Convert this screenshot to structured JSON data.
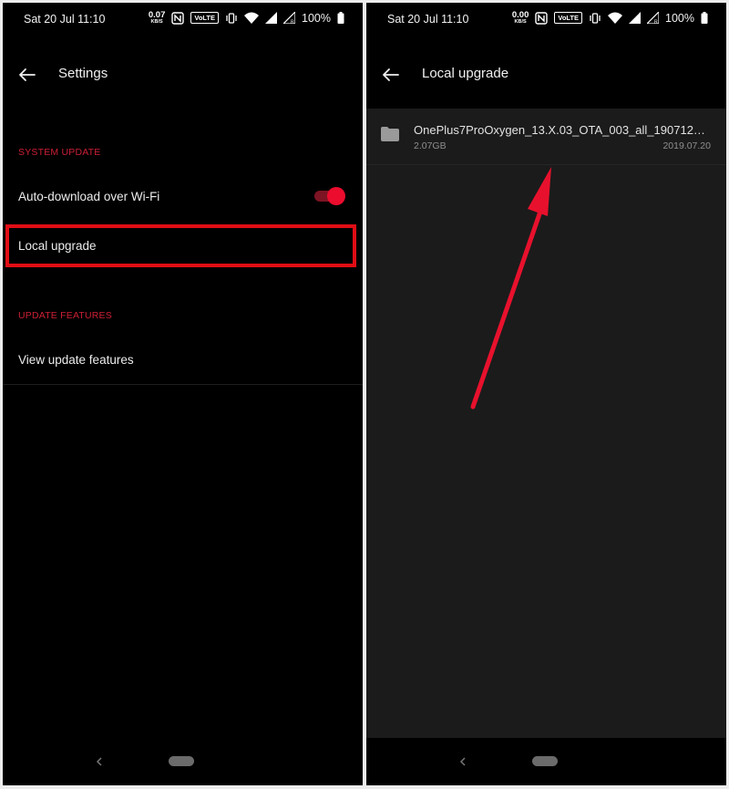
{
  "left_screen": {
    "status_bar": {
      "time": "Sat 20 Jul 11:10",
      "net_speed": "0.07",
      "net_speed_unit": "KB/S",
      "volte": "VoLTE",
      "battery": "100%"
    },
    "app_bar": {
      "title": "Settings"
    },
    "sections": [
      {
        "header": "SYSTEM UPDATE",
        "items": [
          {
            "label": "Auto-download over Wi-Fi",
            "toggle_on": true
          },
          {
            "label": "Local upgrade",
            "highlighted": true
          }
        ]
      },
      {
        "header": "UPDATE FEATURES",
        "items": [
          {
            "label": "View update features"
          }
        ]
      }
    ]
  },
  "right_screen": {
    "status_bar": {
      "time": "Sat 20 Jul 11:10",
      "net_speed": "0.00",
      "net_speed_unit": "KB/S",
      "volte": "VoLTE",
      "battery": "100%"
    },
    "app_bar": {
      "title": "Local upgrade"
    },
    "files": [
      {
        "name": "OnePlus7ProOxygen_13.X.03_OTA_003_all_19071222...",
        "size": "2.07GB",
        "date": "2019.07.20",
        "icon": "folder-icon"
      }
    ]
  },
  "colors": {
    "accent": "#eb0c2e",
    "section_header": "#cc1f34",
    "highlight_box": "#e10d15",
    "annotation_arrow": "#e8112d"
  }
}
